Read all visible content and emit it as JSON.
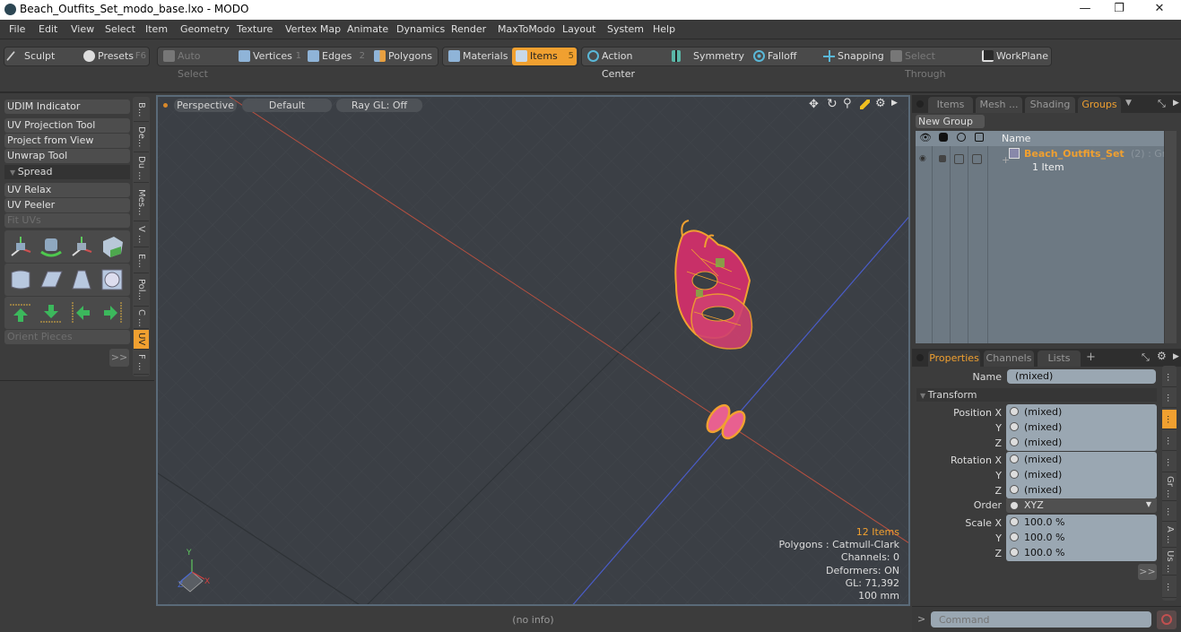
{
  "window": {
    "title": "Beach_Outfits_Set_modo_base.lxo - MODO",
    "minimize": "—",
    "maximize": "❐",
    "close": "✕"
  },
  "menu": [
    "File",
    "Edit",
    "View",
    "Select",
    "Item",
    "Geometry",
    "Texture",
    "Vertex Map",
    "Animate",
    "Dynamics",
    "Render",
    "MaxToModo",
    "Layout",
    "System",
    "Help"
  ],
  "toolbar": {
    "sculpt": "Sculpt",
    "presets": "Presets",
    "presets_key": "F6",
    "auto_select": "Auto Select",
    "vertices": "Vertices",
    "vertices_key": "1",
    "edges": "Edges",
    "edges_key": "2",
    "polygons": "Polygons",
    "materials": "Materials",
    "items": "Items",
    "items_key": "5",
    "action_center": "Action Center",
    "symmetry": "Symmetry",
    "falloff": "Falloff",
    "snapping": "Snapping",
    "select_through": "Select Through",
    "workplane": "WorkPlane",
    "accent": "#f0a030"
  },
  "left_panel": {
    "udim": "UDIM Indicator",
    "uv_projection": "UV Projection Tool",
    "project_from_view": "Project from View",
    "unwrap": "Unwrap Tool",
    "spread": "Spread",
    "uv_relax": "UV Relax",
    "uv_peeler": "UV Peeler",
    "fit_uvs": "Fit UVs",
    "orient_pieces": "Orient Pieces",
    "more": ">>",
    "vertical_tabs": [
      "B...",
      "De...",
      "Du ...",
      "Mes...",
      "V ...",
      "E...",
      "Pol...",
      "C ...",
      "UV",
      "F ..."
    ],
    "active_tab": "UV"
  },
  "viewport": {
    "view": "Perspective",
    "shading": "Default",
    "raygl": "Ray GL: Off",
    "info": {
      "items": "12 Items",
      "polygons": "Polygons : Catmull-Clark",
      "channels": "Channels: 0",
      "deformers": "Deformers: ON",
      "gl": "GL: 71,392",
      "unit": "100 mm"
    },
    "axis_labels": {
      "x": "X",
      "y": "Y",
      "z": "Z"
    }
  },
  "status": {
    "info": "(no info)"
  },
  "groups_panel": {
    "tabs": [
      "Items",
      "Mesh ...",
      "Shading",
      "Groups"
    ],
    "active_tab": "Groups",
    "new_group": "New Group",
    "col_name": "Name",
    "group_name": "Beach_Outfits_Set",
    "group_suffix": "(2) : Gr...",
    "group_count": "1 Item"
  },
  "properties_panel": {
    "tabs": [
      "Properties",
      "Channels",
      "Lists"
    ],
    "add_tab": "+",
    "active_tab": "Properties",
    "name_label": "Name",
    "name_value": "(mixed)",
    "section": "Transform",
    "position": {
      "label_x": "Position X",
      "label_y": "Y",
      "label_z": "Z",
      "x": "(mixed)",
      "y": "(mixed)",
      "z": "(mixed)"
    },
    "rotation": {
      "label_x": "Rotation X",
      "label_y": "Y",
      "label_z": "Z",
      "x": "(mixed)",
      "y": "(mixed)",
      "z": "(mixed)"
    },
    "order": {
      "label": "Order",
      "value": "XYZ"
    },
    "scale": {
      "label_x": "Scale X",
      "label_y": "Y",
      "label_z": "Z",
      "x": "100.0 %",
      "y": "100.0 %",
      "z": "100.0 %"
    },
    "more": ">>",
    "side_tabs": [
      "...",
      "...",
      "...",
      "...",
      "...",
      "Gr ...",
      "...",
      "A ...",
      "Us ...",
      "..."
    ]
  },
  "command": {
    "prompt": ">",
    "placeholder": "Command"
  }
}
